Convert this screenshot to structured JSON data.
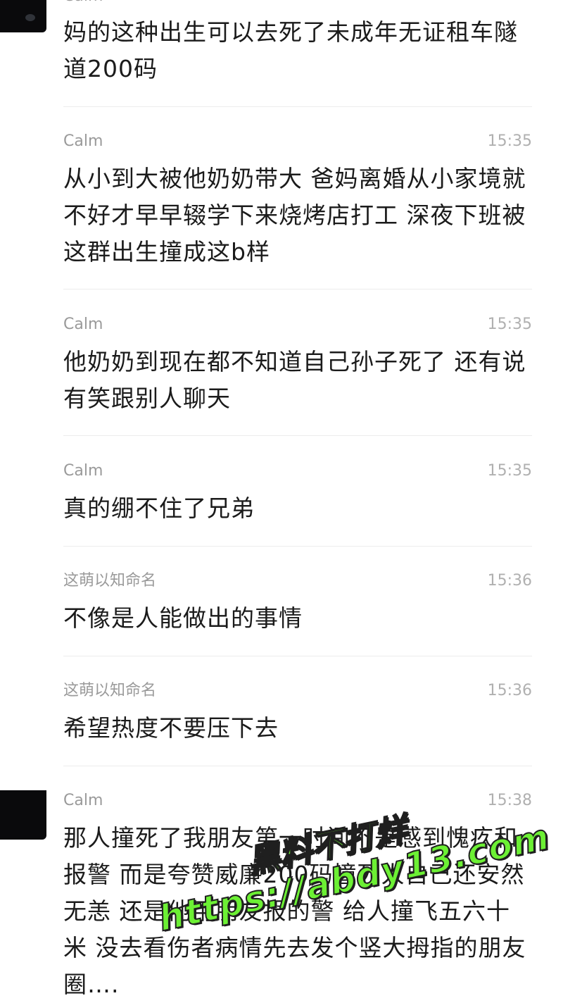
{
  "messages": [
    {
      "sender": "Calm",
      "time": "",
      "text": "妈的这种出生可以去死了未成年无证租车隧道200码",
      "avatar": true
    },
    {
      "sender": "Calm",
      "time": "15:35",
      "text": "从小到大被他奶奶带大 爸妈离婚从小家境就不好才早早辍学下来烧烤店打工 深夜下班被这群出生撞成这b样",
      "avatar": false
    },
    {
      "sender": "Calm",
      "time": "15:35",
      "text": "他奶奶到现在都不知道自己孙子死了 还有说有笑跟别人聊天",
      "avatar": false
    },
    {
      "sender": "Calm",
      "time": "15:35",
      "text": "真的绷不住了兄弟",
      "avatar": false
    },
    {
      "sender": "这萌以知命名",
      "time": "15:36",
      "text": "不像是人能做出的事情",
      "avatar": false
    },
    {
      "sender": "这萌以知命名",
      "time": "15:36",
      "text": "希望热度不要压下去",
      "avatar": false
    },
    {
      "sender": "Calm",
      "time": "15:38",
      "text": "那人撞死了我朋友第一时间不是感到愧疚和报警 而是夸赞威廉200码撞死人自己还安然无恙 还是他用朋友报的警 给人撞飞五六十米 没去看伤者病情先去发个竖大拇指的朋友圈….",
      "avatar": true
    }
  ],
  "watermark": {
    "line1": "黑料不打烊",
    "line2": "https://abdy13.com",
    "color": "#6cf034"
  },
  "colors": {
    "sender": "#9a9a9a",
    "time": "#b0b0b0",
    "text": "#1b1b1b",
    "divider": "#ececec",
    "avatar": "#0a0a0c"
  }
}
